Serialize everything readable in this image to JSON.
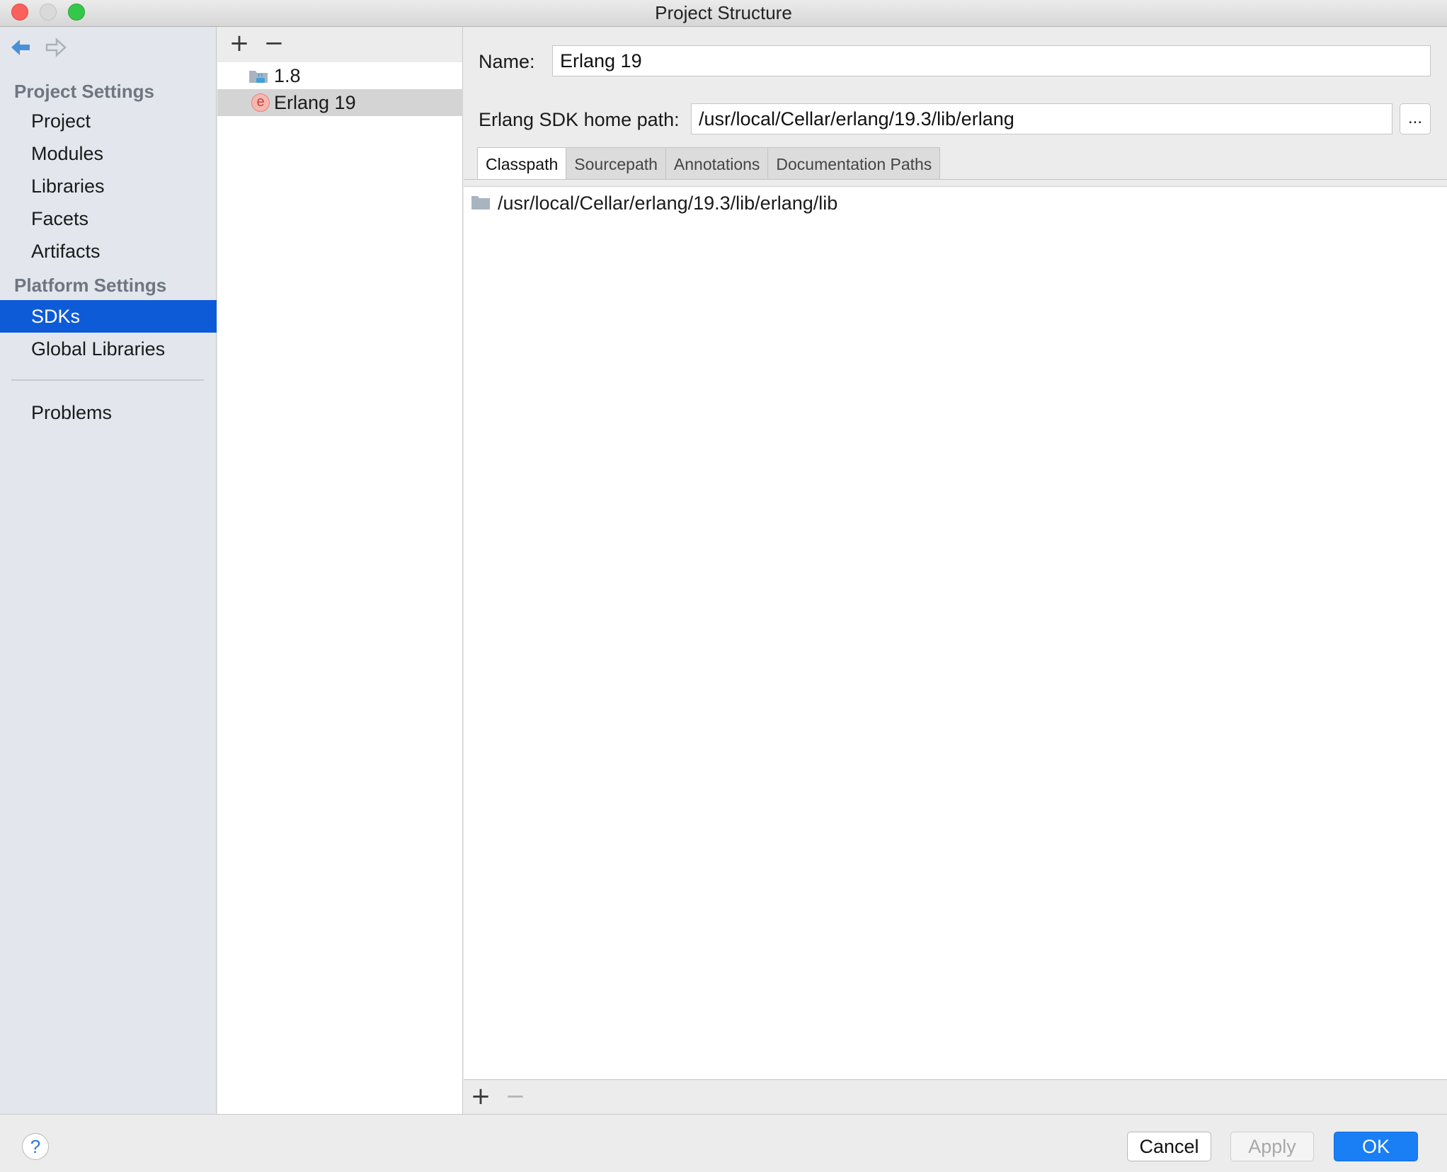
{
  "window": {
    "title": "Project Structure"
  },
  "nav": {
    "project_settings_title": "Project Settings",
    "project_items": [
      "Project",
      "Modules",
      "Libraries",
      "Facets",
      "Artifacts"
    ],
    "platform_settings_title": "Platform Settings",
    "platform_items": [
      "SDKs",
      "Global Libraries"
    ],
    "selected": "SDKs",
    "problems": "Problems"
  },
  "sdk_list": {
    "items": [
      {
        "label": "1.8",
        "icon": "java-sdk-folder-icon"
      },
      {
        "label": "Erlang 19",
        "icon": "erlang-icon",
        "icon_letter": "e"
      }
    ],
    "selected": "Erlang 19"
  },
  "detail": {
    "name_label": "Name:",
    "name_value": "Erlang 19",
    "home_label": "Erlang SDK home path:",
    "home_value": "/usr/local/Cellar/erlang/19.3/lib/erlang",
    "browse_label": "...",
    "tabs": [
      "Classpath",
      "Sourcepath",
      "Annotations",
      "Documentation Paths"
    ],
    "active_tab": "Classpath",
    "paths": [
      "/usr/local/Cellar/erlang/19.3/lib/erlang/lib"
    ]
  },
  "toolbar": {
    "add": "+",
    "remove": "−"
  },
  "footer": {
    "help": "?",
    "cancel": "Cancel",
    "apply": "Apply",
    "ok": "OK"
  },
  "colors": {
    "selection_blue": "#0e5bd8",
    "ok_button": "#1a7ff5",
    "close": "#fc605c",
    "zoom": "#34c84a"
  }
}
